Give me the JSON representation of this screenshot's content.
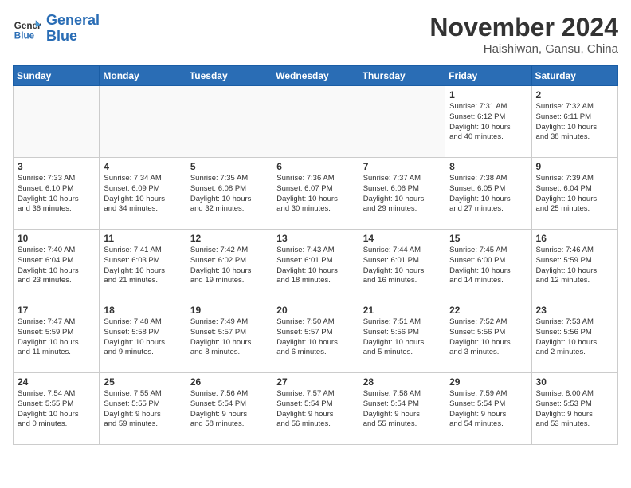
{
  "header": {
    "logo_line1": "General",
    "logo_line2": "Blue",
    "month": "November 2024",
    "location": "Haishiwan, Gansu, China"
  },
  "weekdays": [
    "Sunday",
    "Monday",
    "Tuesday",
    "Wednesday",
    "Thursday",
    "Friday",
    "Saturday"
  ],
  "weeks": [
    [
      {
        "day": "",
        "info": ""
      },
      {
        "day": "",
        "info": ""
      },
      {
        "day": "",
        "info": ""
      },
      {
        "day": "",
        "info": ""
      },
      {
        "day": "",
        "info": ""
      },
      {
        "day": "1",
        "info": "Sunrise: 7:31 AM\nSunset: 6:12 PM\nDaylight: 10 hours\nand 40 minutes."
      },
      {
        "day": "2",
        "info": "Sunrise: 7:32 AM\nSunset: 6:11 PM\nDaylight: 10 hours\nand 38 minutes."
      }
    ],
    [
      {
        "day": "3",
        "info": "Sunrise: 7:33 AM\nSunset: 6:10 PM\nDaylight: 10 hours\nand 36 minutes."
      },
      {
        "day": "4",
        "info": "Sunrise: 7:34 AM\nSunset: 6:09 PM\nDaylight: 10 hours\nand 34 minutes."
      },
      {
        "day": "5",
        "info": "Sunrise: 7:35 AM\nSunset: 6:08 PM\nDaylight: 10 hours\nand 32 minutes."
      },
      {
        "day": "6",
        "info": "Sunrise: 7:36 AM\nSunset: 6:07 PM\nDaylight: 10 hours\nand 30 minutes."
      },
      {
        "day": "7",
        "info": "Sunrise: 7:37 AM\nSunset: 6:06 PM\nDaylight: 10 hours\nand 29 minutes."
      },
      {
        "day": "8",
        "info": "Sunrise: 7:38 AM\nSunset: 6:05 PM\nDaylight: 10 hours\nand 27 minutes."
      },
      {
        "day": "9",
        "info": "Sunrise: 7:39 AM\nSunset: 6:04 PM\nDaylight: 10 hours\nand 25 minutes."
      }
    ],
    [
      {
        "day": "10",
        "info": "Sunrise: 7:40 AM\nSunset: 6:04 PM\nDaylight: 10 hours\nand 23 minutes."
      },
      {
        "day": "11",
        "info": "Sunrise: 7:41 AM\nSunset: 6:03 PM\nDaylight: 10 hours\nand 21 minutes."
      },
      {
        "day": "12",
        "info": "Sunrise: 7:42 AM\nSunset: 6:02 PM\nDaylight: 10 hours\nand 19 minutes."
      },
      {
        "day": "13",
        "info": "Sunrise: 7:43 AM\nSunset: 6:01 PM\nDaylight: 10 hours\nand 18 minutes."
      },
      {
        "day": "14",
        "info": "Sunrise: 7:44 AM\nSunset: 6:01 PM\nDaylight: 10 hours\nand 16 minutes."
      },
      {
        "day": "15",
        "info": "Sunrise: 7:45 AM\nSunset: 6:00 PM\nDaylight: 10 hours\nand 14 minutes."
      },
      {
        "day": "16",
        "info": "Sunrise: 7:46 AM\nSunset: 5:59 PM\nDaylight: 10 hours\nand 12 minutes."
      }
    ],
    [
      {
        "day": "17",
        "info": "Sunrise: 7:47 AM\nSunset: 5:59 PM\nDaylight: 10 hours\nand 11 minutes."
      },
      {
        "day": "18",
        "info": "Sunrise: 7:48 AM\nSunset: 5:58 PM\nDaylight: 10 hours\nand 9 minutes."
      },
      {
        "day": "19",
        "info": "Sunrise: 7:49 AM\nSunset: 5:57 PM\nDaylight: 10 hours\nand 8 minutes."
      },
      {
        "day": "20",
        "info": "Sunrise: 7:50 AM\nSunset: 5:57 PM\nDaylight: 10 hours\nand 6 minutes."
      },
      {
        "day": "21",
        "info": "Sunrise: 7:51 AM\nSunset: 5:56 PM\nDaylight: 10 hours\nand 5 minutes."
      },
      {
        "day": "22",
        "info": "Sunrise: 7:52 AM\nSunset: 5:56 PM\nDaylight: 10 hours\nand 3 minutes."
      },
      {
        "day": "23",
        "info": "Sunrise: 7:53 AM\nSunset: 5:56 PM\nDaylight: 10 hours\nand 2 minutes."
      }
    ],
    [
      {
        "day": "24",
        "info": "Sunrise: 7:54 AM\nSunset: 5:55 PM\nDaylight: 10 hours\nand 0 minutes."
      },
      {
        "day": "25",
        "info": "Sunrise: 7:55 AM\nSunset: 5:55 PM\nDaylight: 9 hours\nand 59 minutes."
      },
      {
        "day": "26",
        "info": "Sunrise: 7:56 AM\nSunset: 5:54 PM\nDaylight: 9 hours\nand 58 minutes."
      },
      {
        "day": "27",
        "info": "Sunrise: 7:57 AM\nSunset: 5:54 PM\nDaylight: 9 hours\nand 56 minutes."
      },
      {
        "day": "28",
        "info": "Sunrise: 7:58 AM\nSunset: 5:54 PM\nDaylight: 9 hours\nand 55 minutes."
      },
      {
        "day": "29",
        "info": "Sunrise: 7:59 AM\nSunset: 5:54 PM\nDaylight: 9 hours\nand 54 minutes."
      },
      {
        "day": "30",
        "info": "Sunrise: 8:00 AM\nSunset: 5:53 PM\nDaylight: 9 hours\nand 53 minutes."
      }
    ]
  ]
}
